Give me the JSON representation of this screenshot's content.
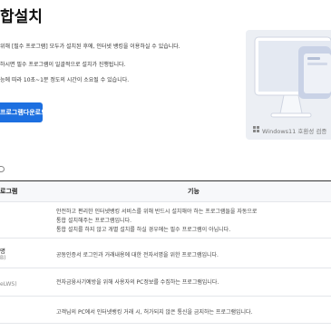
{
  "page": {
    "title": "합설치",
    "desc_lines": [
      "위해 [필수 프로그램] 모두가 설치된 후에, 인터넷 뱅킹을 이용하실 수 있습니다.",
      "하시면 필수 프로그램이 일괄적으로 설치가 진행됩니다.",
      "능에 따라 10초~1분 정도의 시간이 소요될 수 있습니다."
    ],
    "download_button": "프로그램다운로드",
    "compat_label": "Windows11 호환성 검증"
  },
  "table": {
    "headers": [
      "로그램",
      "기능"
    ],
    "rows": [
      {
        "name": "",
        "sub": "",
        "desc": [
          "안전하고 편리한 인터넷뱅킹 서비스를 위해 반드시 설치해야 하는 프로그램들을 자동으로",
          "통합 설치해주는 프로그램입니다.",
          "통합 설치를 하지 않고 개별 설치를 하실 경우에는 필수 프로그램이 아닙니다."
        ]
      },
      {
        "name": "명",
        "sub": "B)",
        "desc": [
          "공동인증서 로그인과 거래내용에 대한 전자서명을 위한 프로그램입니다."
        ]
      },
      {
        "name": "",
        "sub": "eLWS)",
        "desc": [
          "전자금융사기예방을 위해 사용자의 PC정보를 수집하는 프로그램입니다."
        ]
      },
      {
        "name": "",
        "sub": "",
        "desc": [
          "고객님의 PC에서 인터넷뱅킹 거래 시, 허가되지 않은 통신을 금지하는 프로그램입니다."
        ]
      }
    ]
  },
  "colors": {
    "accent": "#1c6fe0",
    "hero_bg": "#eceff4",
    "screen": "#c9d2e6"
  },
  "icons": [
    "monitor-illustration",
    "windows-icon",
    "info-icon"
  ]
}
